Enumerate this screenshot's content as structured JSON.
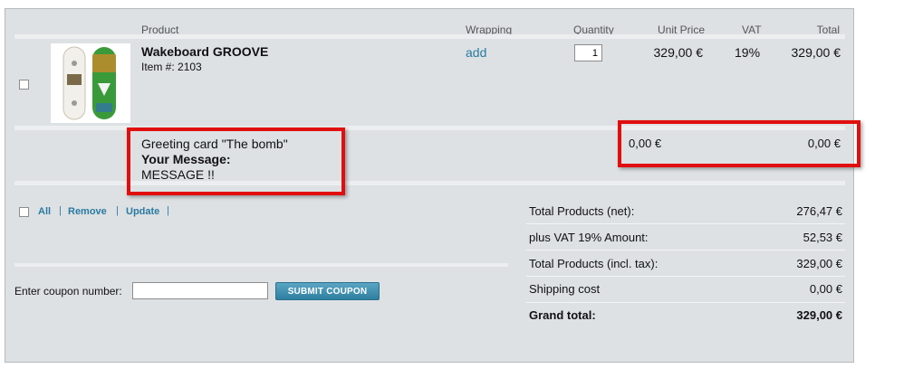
{
  "headers": {
    "product": "Product",
    "wrapping": "Wrapping",
    "quantity": "Quantity",
    "unit_price": "Unit Price",
    "vat": "VAT",
    "total": "Total"
  },
  "item": {
    "name": "Wakeboard GROOVE",
    "item_no": "Item #: 2103",
    "wrapping_link": "add",
    "quantity": "1",
    "unit_price": "329,00 €",
    "vat": "19%",
    "total": "329,00 €"
  },
  "greeting": {
    "card": "Greeting card \"The bomb\"",
    "message_label": "Your Message:",
    "message": "MESSAGE !!",
    "unit_price": "0,00 €",
    "total": "0,00 €"
  },
  "actions": {
    "all": "All",
    "remove": "Remove",
    "update": "Update",
    "separator": "|"
  },
  "coupon": {
    "label": "Enter coupon number:",
    "value": "",
    "button": "SUBMIT COUPON"
  },
  "summary": [
    {
      "label": "Total Products (net):",
      "value": "276,47 €"
    },
    {
      "label": "plus VAT 19% Amount:",
      "value": "52,53 €"
    },
    {
      "label": "Total Products (incl. tax):",
      "value": "329,00 €"
    },
    {
      "label": "Shipping cost",
      "value": "0,00 €"
    },
    {
      "label": "Grand total:",
      "value": "329,00 €"
    }
  ],
  "colors": {
    "panel": "#dde1e4",
    "link": "#2a7ba0",
    "highlight": "#e10e0e",
    "button": "#3a8db0"
  }
}
